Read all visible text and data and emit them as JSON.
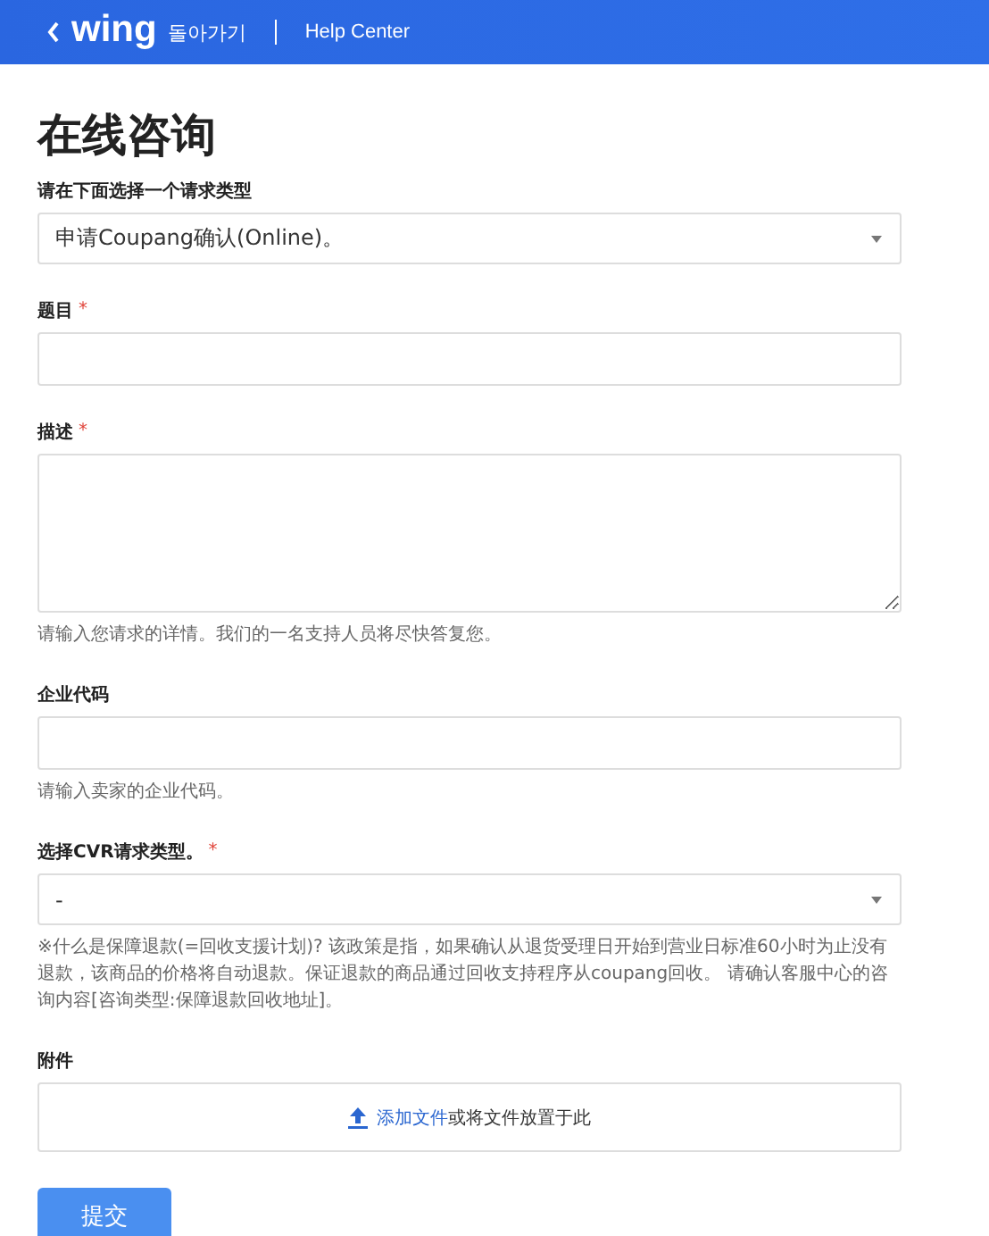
{
  "header": {
    "logo": "wing",
    "back_label": "돌아가기",
    "section": "Help Center"
  },
  "title": "在线咨询",
  "fields": [
    {
      "kind": "select",
      "label": "请在下面选择一个请求类型",
      "value": "申请Coupang确认(Online)。"
    },
    {
      "kind": "text",
      "label": "题目",
      "required_mark": "*"
    },
    {
      "kind": "textarea",
      "label": "描述",
      "required_mark": "*",
      "hint": "请输入您请求的详情。我们的一名支持人员将尽快答复您。"
    },
    {
      "kind": "text",
      "label": "企业代码",
      "hint": "请输入卖家的企业代码。"
    },
    {
      "kind": "select",
      "label": "选择CVR请求类型。",
      "required_mark": "*",
      "value": "-",
      "hint": "※什么是保障退款(=回收支援计划)? 该政策是指，如果确认从退货受理日开始到营业日标准60小时为止没有退款，该商品的价格将自动退款。保证退款的商品通过回收支持程序从coupang回收。 请确认客服中心的咨询内容[咨询类型:保障退款回收地址]。"
    },
    {
      "kind": "upload",
      "label": "附件",
      "link": "添加文件",
      "text": "或将文件放置于此"
    }
  ],
  "submit": "提交"
}
